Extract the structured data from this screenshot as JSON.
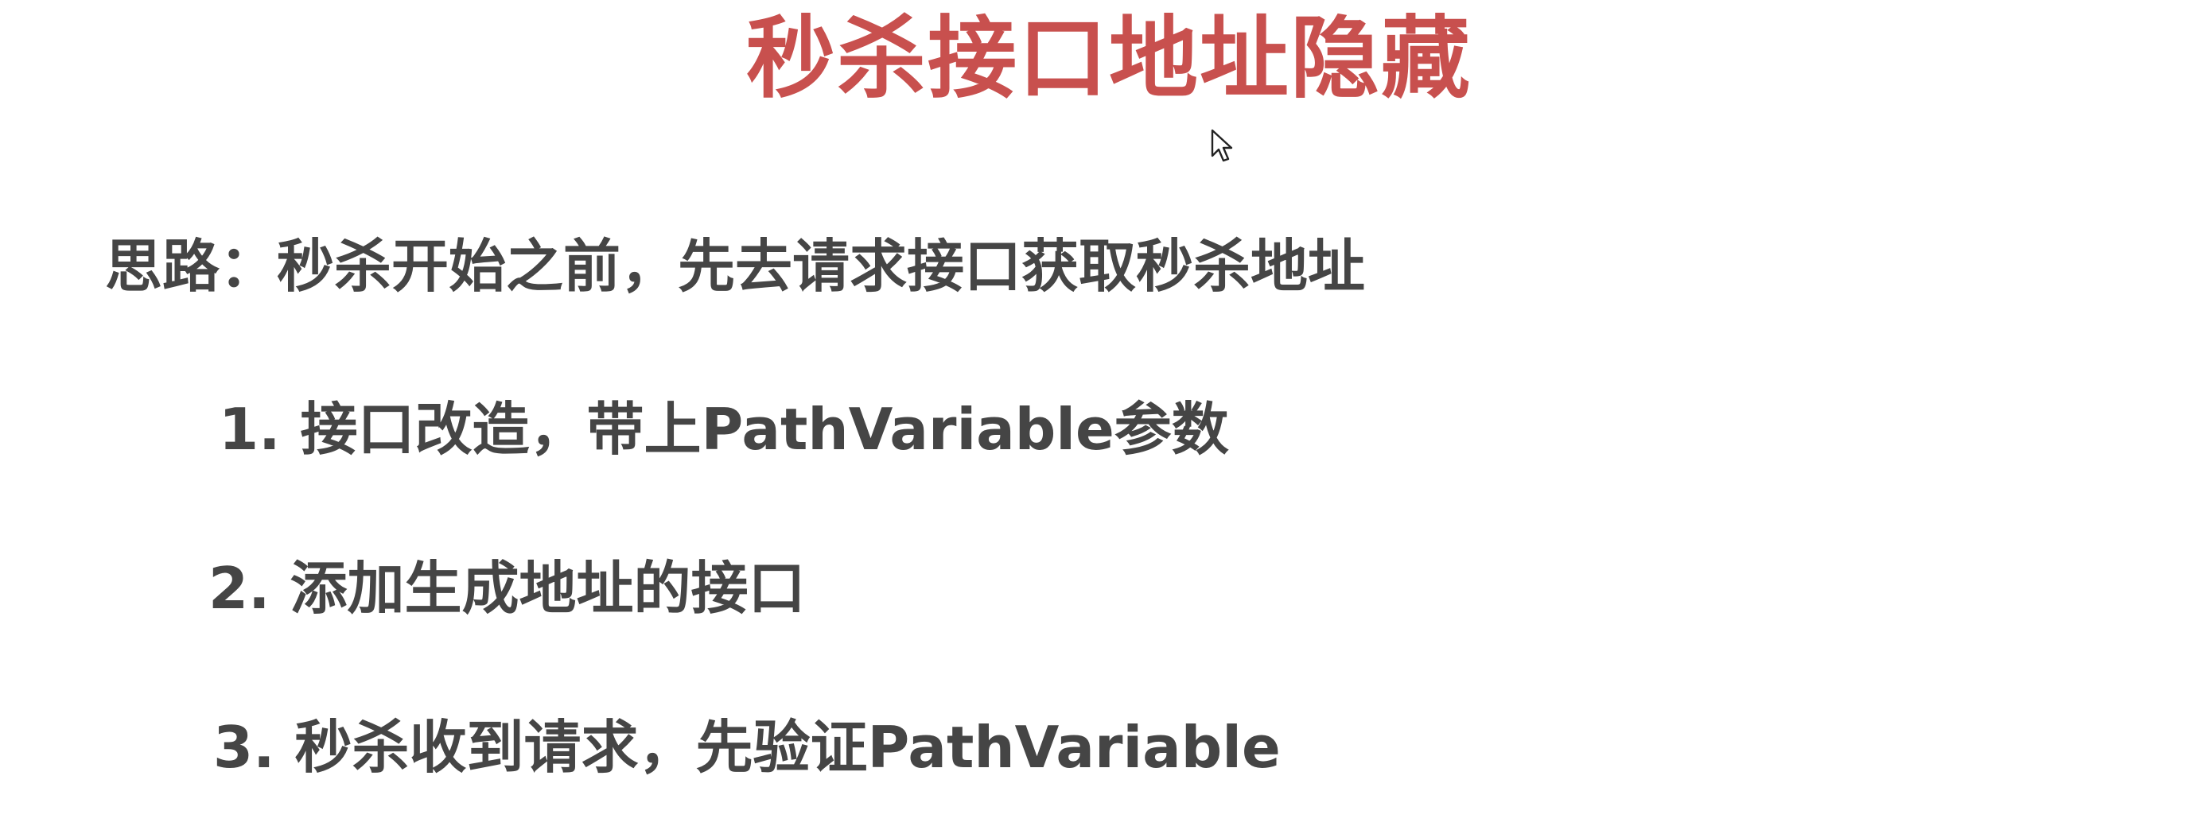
{
  "slide": {
    "title": "秒杀接口地址隐藏",
    "idea": "思路：秒杀开始之前，先去请求接口获取秒杀地址",
    "steps": [
      "1. 接口改造，带上PathVariable参数",
      "2. 添加生成地址的接口",
      "3. 秒杀收到请求，先验证PathVariable"
    ]
  },
  "colors": {
    "title": "#c8504e",
    "body_text": "#454545",
    "background": "#ffffff"
  },
  "icons": {
    "cursor": "mouse-pointer-icon"
  }
}
